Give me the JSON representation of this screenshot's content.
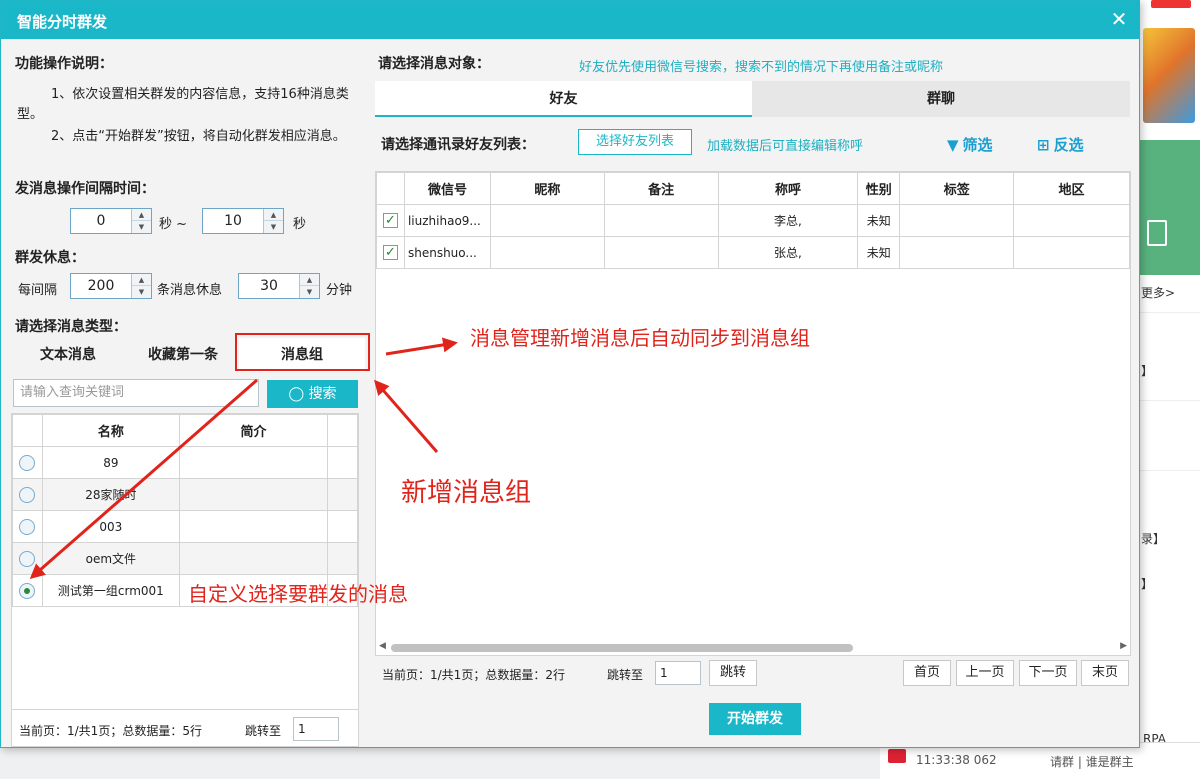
{
  "dialog": {
    "title": "智能分时群发",
    "close_label": "✕"
  },
  "left": {
    "help_heading": "功能操作说明：",
    "help_1": "1、依次设置相关群发的内容信息，支持16种消息类型。",
    "help_2": "2、点击“开始群发”按钮，将自动化群发相应消息。",
    "interval_heading": "发消息操作间隔时间：",
    "interval_min": "0",
    "interval_sep": "秒 ~",
    "interval_max": "10",
    "interval_unit": "秒",
    "rest_heading": "群发休息：",
    "rest_every": "每间隔",
    "rest_count": "200",
    "rest_mid": "条消息休息",
    "rest_minutes": "30",
    "rest_unit": "分钟",
    "type_heading": "请选择消息类型：",
    "tabs": [
      "文本消息",
      "收藏第一条",
      "消息组"
    ],
    "search_placeholder": "请输入查询关键词",
    "search_button": "搜索",
    "columns": [
      "名称",
      "简介"
    ],
    "rows": [
      {
        "name": "89",
        "intro": "",
        "selected": false
      },
      {
        "name": "28家随时",
        "intro": "",
        "selected": false
      },
      {
        "name": "003",
        "intro": "",
        "selected": false
      },
      {
        "name": "oem文件",
        "intro": "",
        "selected": false
      },
      {
        "name": "测试第一组crm001",
        "intro": "",
        "selected": true
      }
    ],
    "pager_text": "当前页：1/共1页；总数据量：5行",
    "jump_label": "跳转至",
    "jump_value": "1"
  },
  "right": {
    "target_heading": "请选择消息对象：",
    "target_hint": "好友优先使用微信号搜索，搜索不到的情况下再使用备注或昵称",
    "tabs": [
      "好友",
      "群聊"
    ],
    "contacts_heading": "请选择通讯录好友列表：",
    "choose_button": "选择好友列表",
    "edit_hint": "加载数据后可直接编辑称呼",
    "filter_button": "筛选",
    "invert_button": "反选",
    "columns": [
      "微信号",
      "昵称",
      "备注",
      "称呼",
      "性别",
      "标签",
      "地区"
    ],
    "rows": [
      {
        "wxid": "liuzhihao9...",
        "nickname": "",
        "remark": "",
        "title": "李总,",
        "gender": "未知",
        "tag": "",
        "region": "",
        "checked": true
      },
      {
        "wxid": "shenshuo...",
        "nickname": "",
        "remark": "",
        "title": "张总,",
        "gender": "未知",
        "tag": "",
        "region": "",
        "checked": true
      }
    ],
    "pager_text": "当前页：1/共1页；总数据量：2行",
    "jump_label": "跳转至",
    "jump_value": "1",
    "jump_button": "跳转",
    "first_page": "首页",
    "prev_page": "上一页",
    "next_page": "下一页",
    "last_page": "末页",
    "start_button": "开始群发"
  },
  "annotations": {
    "sync_note": "消息管理新增消息后自动同步到消息组",
    "new_group_note": "新增消息组",
    "custom_note": "自定义选择要群发的消息",
    "color": "#e0241b"
  },
  "background": {
    "more": "更多>",
    "b1": "】",
    "b2": "录】",
    "b3": "】",
    "rpa": "RPA",
    "bottom_time": "11:33:38 062",
    "bottom_text": "请群 | 谁是群主"
  },
  "colors": {
    "accent": "#1ab7c9",
    "annotation": "#e0241b",
    "link": "#1a9fd0"
  }
}
